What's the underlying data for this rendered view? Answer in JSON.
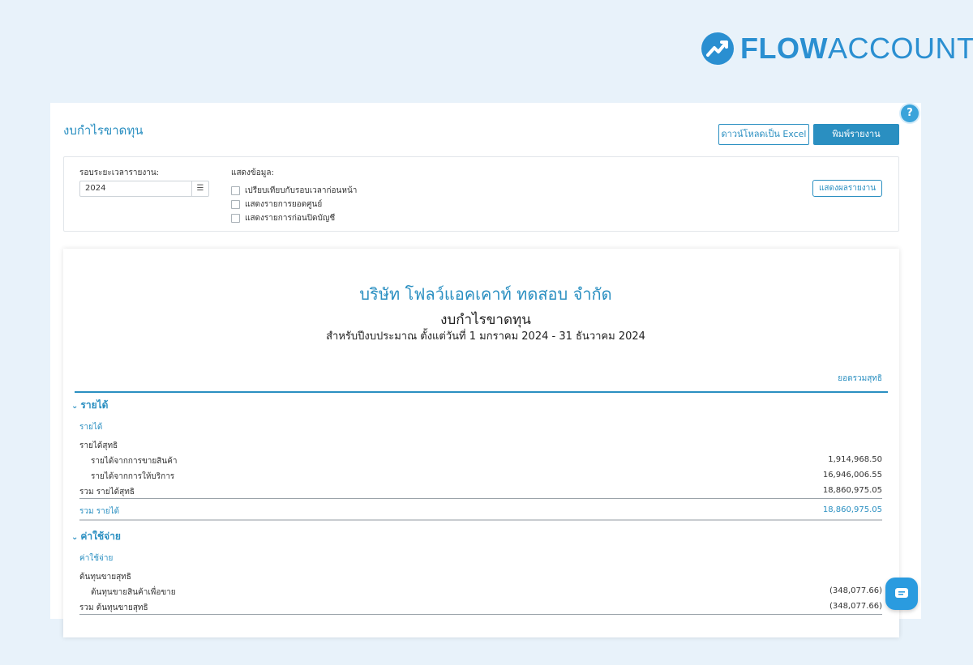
{
  "brand": {
    "logo_strong": "FLOW",
    "logo_rest": "ACCOUNT",
    "accent": "#2a8fc1"
  },
  "header": {
    "title": "งบกำไรขาดทุน",
    "excel_button": "ดาวน์โหลดเป็น Excel",
    "print_button": "พิมพ์รายงาน",
    "help": "?"
  },
  "filters": {
    "period_label": "รอบระยะเวลารายงาน:",
    "period_value": "2024",
    "display_label": "แสดงข้อมูล:",
    "options": [
      "เปรียบเทียบกับรอบเวลาก่อนหน้า",
      "แสดงรายการยอดศูนย์",
      "แสดงรายการก่อนปิดบัญชี"
    ],
    "show_button": "แสดงผลรายงาน"
  },
  "report": {
    "company": "บริษัท โฟลว์แอคเคาท์ ทดสอบ จำกัด",
    "title": "งบกำไรขาดทุน",
    "period": "สำหรับปีงบประมาณ ตั้งแต่วันที่ 1 มกราคม 2024 - 31 ธันวาคม 2024",
    "column_header": "ยอดรวมสุทธิ",
    "income": {
      "section": "รายได้",
      "group": "รายได้",
      "subgroup": "รายได้สุทธิ",
      "lines": [
        {
          "label": "รายได้จากการขายสินค้า",
          "amount": "1,914,968.50"
        },
        {
          "label": "รายได้จากการให้บริการ",
          "amount": "16,946,006.55"
        }
      ],
      "subtotal_label": "รวม รายได้สุทธิ",
      "subtotal_amount": "18,860,975.05",
      "total_label": "รวม รายได้",
      "total_amount": "18,860,975.05"
    },
    "expense": {
      "section": "ค่าใช้จ่าย",
      "group": "ค่าใช้จ่าย",
      "subgroup": "ต้นทุนขายสุทธิ",
      "lines": [
        {
          "label": "ต้นทุนขายสินค้าเพื่อขาย",
          "amount": "(348,077.66)"
        }
      ],
      "subtotal_label": "รวม ต้นทุนขายสุทธิ",
      "subtotal_amount": "(348,077.66)"
    }
  }
}
